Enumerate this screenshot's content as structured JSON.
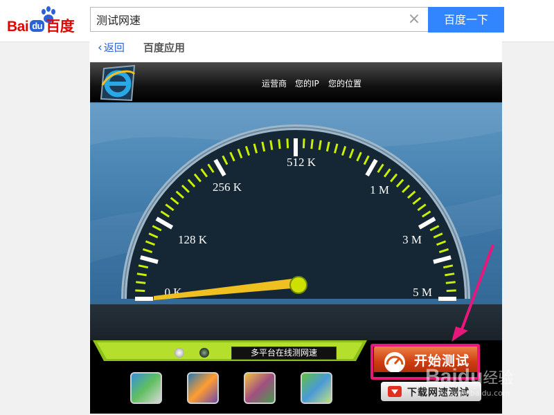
{
  "topbar": {
    "logo_text": "Bai",
    "logo_du": "du",
    "logo_cn": "百度",
    "search_value": "测试网速",
    "clear_symbol": "×",
    "search_button": "百度一下"
  },
  "nav": {
    "back_label": "返回",
    "title": "百度应用"
  },
  "app": {
    "header": {
      "carrier_label": "运营商",
      "ip_label": "您的IP",
      "location_label": "您的位置"
    },
    "gauge": {
      "scale_labels": [
        "0 K",
        "128 K",
        "256 K",
        "512 K",
        "1 M",
        "3 M",
        "5 M"
      ],
      "needle_value": "0 K"
    },
    "controls": {
      "platform_label": "多平台在线测网速",
      "start_button": "开始测试",
      "download_button": "下载网速测试"
    },
    "app_icons": [
      "app-icon-1",
      "app-icon-2",
      "app-icon-3",
      "app-icon-4"
    ]
  },
  "colors": {
    "search_button": "#3385ff",
    "link": "#2b61d6",
    "highlight": "#e8177c",
    "gauge_ticks": "#c8f000",
    "start_button": "#cf3d12"
  },
  "watermark": {
    "text": "Baidu",
    "suffix": "经验",
    "url": "jingyan.baidu.com"
  }
}
